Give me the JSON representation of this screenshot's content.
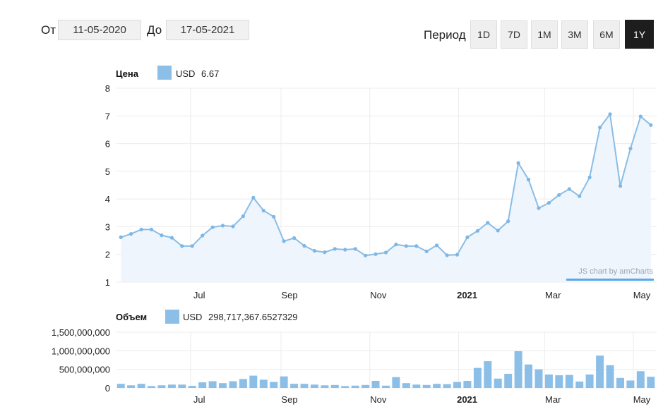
{
  "date_range": {
    "from_label": "От",
    "from_value": "11-05-2020",
    "to_label": "До",
    "to_value": "17-05-2021"
  },
  "period": {
    "label": "Период",
    "options": [
      "1D",
      "7D",
      "1M",
      "3M",
      "6M",
      "1Y"
    ],
    "selected": "1Y"
  },
  "colors": {
    "series": "#8cbfe8",
    "line": "#89bde6",
    "active_button": "#1d1d1d",
    "watermark": "#9aa7b4"
  },
  "watermark": "JS chart by amCharts",
  "chart_data": [
    {
      "type": "line",
      "title": "Цена",
      "legend": {
        "series": "USD",
        "value": "6.67"
      },
      "ylim": [
        1,
        8
      ],
      "yticks": [
        1,
        2,
        3,
        4,
        5,
        6,
        7,
        8
      ],
      "xlim": [
        "2020-05-11",
        "2021-05-17"
      ],
      "xticks": [
        {
          "label": "Jul",
          "date": "2020-07-01"
        },
        {
          "label": "Sep",
          "date": "2020-09-01"
        },
        {
          "label": "Nov",
          "date": "2020-11-01"
        },
        {
          "label": "2021",
          "date": "2021-01-01",
          "bold": true
        },
        {
          "label": "Mar",
          "date": "2021-03-01"
        },
        {
          "label": "May",
          "date": "2021-05-01"
        }
      ],
      "grid": true,
      "area_fill": true,
      "series": [
        {
          "name": "USD",
          "values": [
            [
              "2020-05-14",
              2.62
            ],
            [
              "2020-05-21",
              2.74
            ],
            [
              "2020-05-28",
              2.9
            ],
            [
              "2020-06-04",
              2.9
            ],
            [
              "2020-06-11",
              2.69
            ],
            [
              "2020-06-18",
              2.6
            ],
            [
              "2020-06-25",
              2.3
            ],
            [
              "2020-07-02",
              2.3
            ],
            [
              "2020-07-09",
              2.68
            ],
            [
              "2020-07-16",
              2.98
            ],
            [
              "2020-07-23",
              3.04
            ],
            [
              "2020-07-30",
              3.01
            ],
            [
              "2020-08-06",
              3.38
            ],
            [
              "2020-08-13",
              4.05
            ],
            [
              "2020-08-20",
              3.58
            ],
            [
              "2020-08-27",
              3.36
            ],
            [
              "2020-09-03",
              2.48
            ],
            [
              "2020-09-10",
              2.59
            ],
            [
              "2020-09-17",
              2.31
            ],
            [
              "2020-09-24",
              2.13
            ],
            [
              "2020-10-01",
              2.08
            ],
            [
              "2020-10-08",
              2.2
            ],
            [
              "2020-10-15",
              2.17
            ],
            [
              "2020-10-22",
              2.2
            ],
            [
              "2020-10-29",
              1.96
            ],
            [
              "2020-11-05",
              2.01
            ],
            [
              "2020-11-12",
              2.07
            ],
            [
              "2020-11-19",
              2.36
            ],
            [
              "2020-11-26",
              2.3
            ],
            [
              "2020-12-03",
              2.3
            ],
            [
              "2020-12-10",
              2.11
            ],
            [
              "2020-12-17",
              2.33
            ],
            [
              "2020-12-24",
              1.97
            ],
            [
              "2020-12-31",
              1.99
            ],
            [
              "2021-01-07",
              2.62
            ],
            [
              "2021-01-14",
              2.85
            ],
            [
              "2021-01-21",
              3.14
            ],
            [
              "2021-01-28",
              2.86
            ],
            [
              "2021-02-04",
              3.2
            ],
            [
              "2021-02-11",
              5.3
            ],
            [
              "2021-02-18",
              4.7
            ],
            [
              "2021-02-25",
              3.67
            ],
            [
              "2021-03-04",
              3.86
            ],
            [
              "2021-03-11",
              4.15
            ],
            [
              "2021-03-18",
              4.36
            ],
            [
              "2021-03-25",
              4.1
            ],
            [
              "2021-04-01",
              4.78
            ],
            [
              "2021-04-08",
              6.58
            ],
            [
              "2021-04-15",
              7.06
            ],
            [
              "2021-04-22",
              4.47
            ],
            [
              "2021-04-29",
              5.82
            ],
            [
              "2021-05-06",
              6.98
            ],
            [
              "2021-05-13",
              6.67
            ]
          ]
        }
      ]
    },
    {
      "type": "bar",
      "title": "Объем",
      "legend": {
        "series": "USD",
        "value": "298,717,367.6527329"
      },
      "ylim": [
        0,
        1500000000
      ],
      "yticks": [
        {
          "value": 0,
          "label": "0"
        },
        {
          "value": 500000000,
          "label": "500,000,000"
        },
        {
          "value": 1000000000,
          "label": "1,000,000,000"
        },
        {
          "value": 1500000000,
          "label": "1,500,000,000"
        }
      ],
      "xticks": [
        {
          "label": "Jul",
          "date": "2020-07-01"
        },
        {
          "label": "Sep",
          "date": "2020-09-01"
        },
        {
          "label": "Nov",
          "date": "2020-11-01"
        },
        {
          "label": "2021",
          "date": "2021-01-01",
          "bold": true
        },
        {
          "label": "Mar",
          "date": "2021-03-01"
        },
        {
          "label": "May",
          "date": "2021-05-01"
        }
      ],
      "grid": true,
      "series": [
        {
          "name": "USD",
          "values": [
            [
              "2020-05-14",
              110000000
            ],
            [
              "2020-05-21",
              70000000
            ],
            [
              "2020-05-28",
              110000000
            ],
            [
              "2020-06-04",
              50000000
            ],
            [
              "2020-06-11",
              70000000
            ],
            [
              "2020-06-18",
              90000000
            ],
            [
              "2020-06-25",
              90000000
            ],
            [
              "2020-07-02",
              55000000
            ],
            [
              "2020-07-09",
              150000000
            ],
            [
              "2020-07-16",
              180000000
            ],
            [
              "2020-07-23",
              130000000
            ],
            [
              "2020-07-30",
              180000000
            ],
            [
              "2020-08-06",
              240000000
            ],
            [
              "2020-08-13",
              330000000
            ],
            [
              "2020-08-20",
              220000000
            ],
            [
              "2020-08-27",
              160000000
            ],
            [
              "2020-09-03",
              310000000
            ],
            [
              "2020-09-10",
              110000000
            ],
            [
              "2020-09-17",
              110000000
            ],
            [
              "2020-09-24",
              90000000
            ],
            [
              "2020-10-01",
              70000000
            ],
            [
              "2020-10-08",
              80000000
            ],
            [
              "2020-10-15",
              50000000
            ],
            [
              "2020-10-22",
              60000000
            ],
            [
              "2020-10-29",
              80000000
            ],
            [
              "2020-11-05",
              190000000
            ],
            [
              "2020-11-12",
              60000000
            ],
            [
              "2020-11-19",
              290000000
            ],
            [
              "2020-11-26",
              130000000
            ],
            [
              "2020-12-03",
              90000000
            ],
            [
              "2020-12-10",
              80000000
            ],
            [
              "2020-12-17",
              110000000
            ],
            [
              "2020-12-24",
              100000000
            ],
            [
              "2020-12-31",
              160000000
            ],
            [
              "2021-01-07",
              190000000
            ],
            [
              "2021-01-14",
              540000000
            ],
            [
              "2021-01-21",
              720000000
            ],
            [
              "2021-01-28",
              250000000
            ],
            [
              "2021-02-04",
              380000000
            ],
            [
              "2021-02-11",
              990000000
            ],
            [
              "2021-02-18",
              630000000
            ],
            [
              "2021-02-25",
              500000000
            ],
            [
              "2021-03-04",
              360000000
            ],
            [
              "2021-03-11",
              340000000
            ],
            [
              "2021-03-18",
              350000000
            ],
            [
              "2021-03-25",
              170000000
            ],
            [
              "2021-04-01",
              360000000
            ],
            [
              "2021-04-08",
              870000000
            ],
            [
              "2021-04-15",
              610000000
            ],
            [
              "2021-04-22",
              270000000
            ],
            [
              "2021-04-29",
              200000000
            ],
            [
              "2021-05-06",
              450000000
            ],
            [
              "2021-05-13",
              300000000
            ]
          ]
        }
      ]
    }
  ]
}
